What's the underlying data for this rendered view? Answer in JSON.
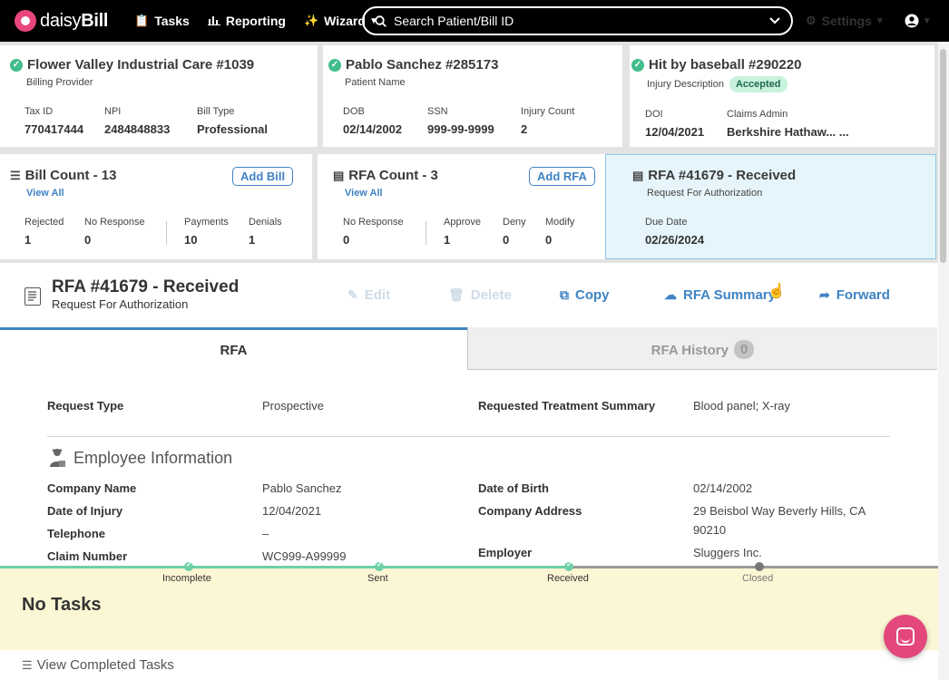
{
  "nav": {
    "brand": "daisyBill",
    "tasks": "Tasks",
    "reporting": "Reporting",
    "wizard": "Wizard",
    "search_placeholder": "Search Patient/Bill ID",
    "settings": "Settings"
  },
  "provider_card": {
    "title": "Flower Valley Industrial Care #1039",
    "subtitle": "Billing Provider",
    "fields": [
      {
        "label": "Tax ID",
        "value": "770417444"
      },
      {
        "label": "NPI",
        "value": "2484848833"
      },
      {
        "label": "Bill Type",
        "value": "Professional"
      }
    ]
  },
  "patient_card": {
    "title": "Pablo Sanchez #285173",
    "subtitle": "Patient Name",
    "fields": [
      {
        "label": "DOB",
        "value": "02/14/2002"
      },
      {
        "label": "SSN",
        "value": "999-99-9999"
      },
      {
        "label": "Injury Count",
        "value": "2"
      }
    ]
  },
  "injury_card": {
    "title": "Hit by baseball #290220",
    "subtitle": "Injury Description",
    "badge": "Accepted",
    "fields": [
      {
        "label": "DOI",
        "value": "12/04/2021"
      },
      {
        "label": "Claims Admin",
        "value": "Berkshire Hathaw... ..."
      }
    ]
  },
  "bill_card": {
    "title": "Bill Count - 13",
    "view_all": "View All",
    "add_button": "Add Bill",
    "fields": [
      {
        "label": "Rejected",
        "value": "1"
      },
      {
        "label": "No Response",
        "value": "0"
      },
      {
        "label": "Payments",
        "value": "10"
      },
      {
        "label": "Denials",
        "value": "1"
      }
    ]
  },
  "rfa_count_card": {
    "title": "RFA Count - 3",
    "view_all": "View All",
    "add_button": "Add RFA",
    "fields": [
      {
        "label": "No Response",
        "value": "0"
      },
      {
        "label": "Approve",
        "value": "1"
      },
      {
        "label": "Deny",
        "value": "0"
      },
      {
        "label": "Modify",
        "value": "0"
      }
    ]
  },
  "rfa_card": {
    "title": "RFA #41679 - Received",
    "subtitle": "Request For Authorization",
    "fields": [
      {
        "label": "Due Date",
        "value": "02/26/2024"
      }
    ]
  },
  "rfa_header": {
    "title": "RFA #41679 - Received",
    "subtitle": "Request For Authorization",
    "actions": {
      "edit": "Edit",
      "delete": "Delete",
      "copy": "Copy",
      "summary": "RFA Summary",
      "forward": "Forward"
    }
  },
  "tabs": {
    "rfa": "RFA",
    "history": "RFA History",
    "history_count": "0"
  },
  "request": {
    "type_label": "Request Type",
    "type_value": "Prospective",
    "summary_label": "Requested Treatment Summary",
    "summary_value": "Blood panel; X-ray"
  },
  "employee": {
    "section_title": "Employee Information",
    "left": [
      {
        "label": "Company Name",
        "value": "Pablo Sanchez"
      },
      {
        "label": "Date of Injury",
        "value": "12/04/2021"
      },
      {
        "label": "Telephone",
        "value": "–"
      },
      {
        "label": "Claim Number",
        "value": "WC999-A99999"
      }
    ],
    "right": [
      {
        "label": "Date of Birth",
        "value": "02/14/2002"
      },
      {
        "label": "Company Address",
        "value_line1": "29 Beisbol Way Beverly Hills, CA",
        "value_line2": "90210"
      },
      {
        "label": "Employer",
        "value": "Sluggers Inc."
      }
    ]
  },
  "timeline": {
    "steps": [
      "Incomplete",
      "Sent",
      "Received",
      "Closed"
    ]
  },
  "tasks": {
    "title": "No Tasks",
    "completed_link": "View Completed Tasks"
  },
  "colors": {
    "accent": "#3f83c4",
    "success": "#41bd8c",
    "tasks_bg": "#fbf6d4",
    "brand_pink": "#e3477c"
  }
}
